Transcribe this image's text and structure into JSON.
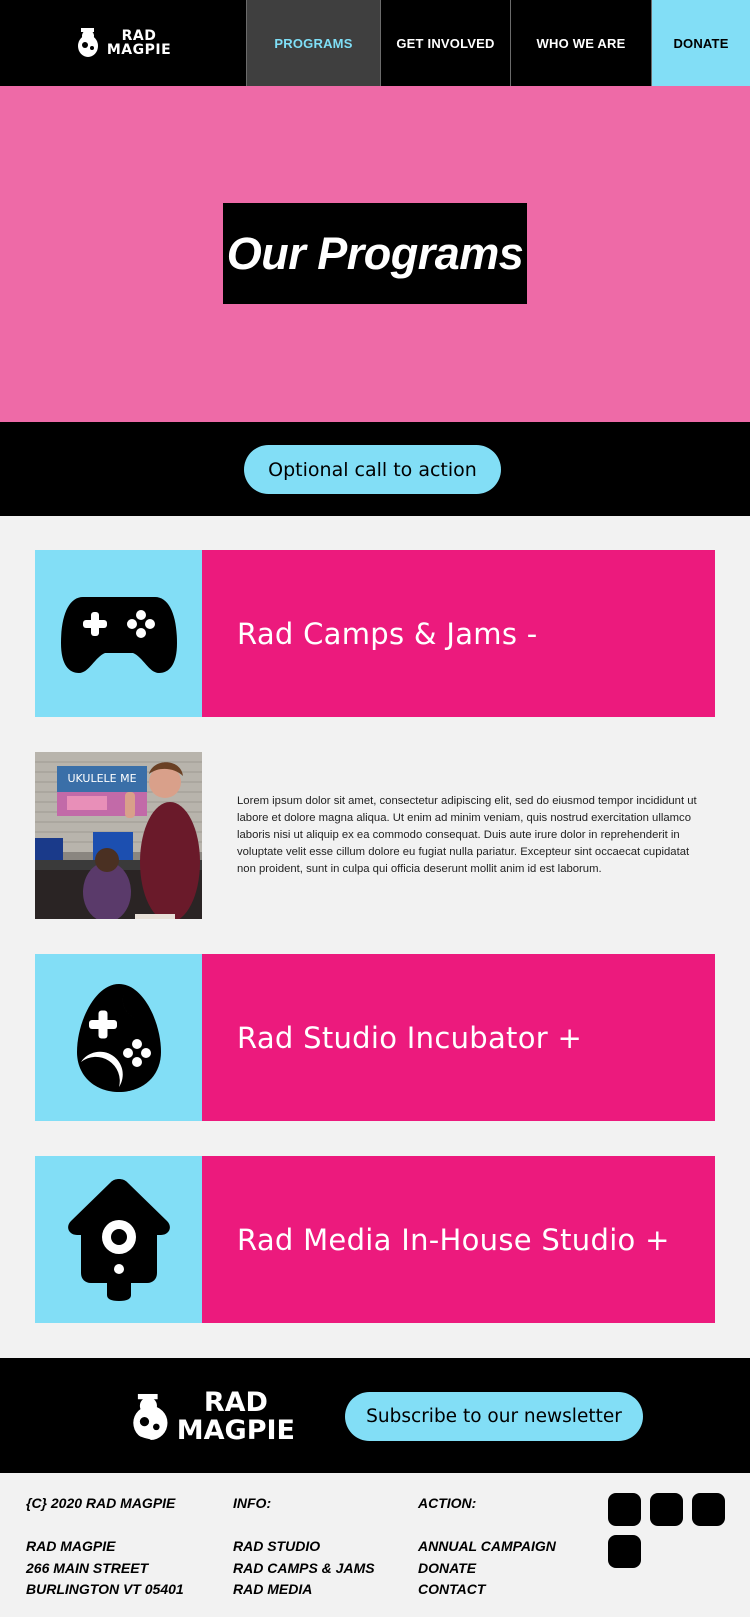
{
  "brand": {
    "logo_line1": "RAD",
    "logo_line2": "MAGPIE"
  },
  "nav": {
    "items": [
      {
        "label": "PROGRAMS"
      },
      {
        "label": "GET INVOLVED"
      },
      {
        "label": "WHO WE ARE"
      },
      {
        "label": "DONATE"
      }
    ]
  },
  "hero": {
    "title": "Our Programs"
  },
  "cta": {
    "label": "Optional call to action"
  },
  "programs": [
    {
      "title": "Rad Camps & Jams -",
      "icon": "gamepad-icon",
      "expanded": true
    },
    {
      "title": "Rad Studio Incubator +",
      "icon": "egg-icon",
      "expanded": false
    },
    {
      "title": "Rad Media In-House Studio +",
      "icon": "birdhouse-icon",
      "expanded": false
    }
  ],
  "expanded_section": {
    "body": "Lorem ipsum dolor sit amet, consectetur adipiscing elit, sed do eiusmod tempor incididunt ut labore et dolore magna aliqua. Ut enim ad minim veniam, quis nostrud exercitation ullamco laboris nisi ut aliquip ex ea commodo consequat. Duis aute irure dolor in reprehenderit in voluptate velit esse cillum dolore eu fugiat nulla pariatur. Excepteur sint occaecat cupidatat non proident, sunt in culpa qui officia deserunt mollit anim id est laborum.",
    "photo_banner_text": "UKULELE ME"
  },
  "footer": {
    "subscribe_label": "Subscribe to our newsletter",
    "copyright": "{C} 2020 RAD MAGPIE",
    "address": [
      "RAD MAGPIE",
      "266 MAIN STREET",
      "BURLINGTON VT 05401"
    ],
    "info": {
      "heading": "INFO:",
      "links": [
        "RAD STUDIO",
        "RAD CAMPS & JAMS",
        "RAD MEDIA"
      ]
    },
    "action": {
      "heading": "ACTION:",
      "links": [
        "ANNUAL CAMPAIGN",
        "DONATE",
        "CONTACT"
      ]
    },
    "social_count": 4
  },
  "colors": {
    "black": "#000000",
    "pink_hero": "#ee6aa7",
    "magenta": "#ec1a7d",
    "cyan": "#82def6",
    "light_gray": "#f2f2f2"
  }
}
